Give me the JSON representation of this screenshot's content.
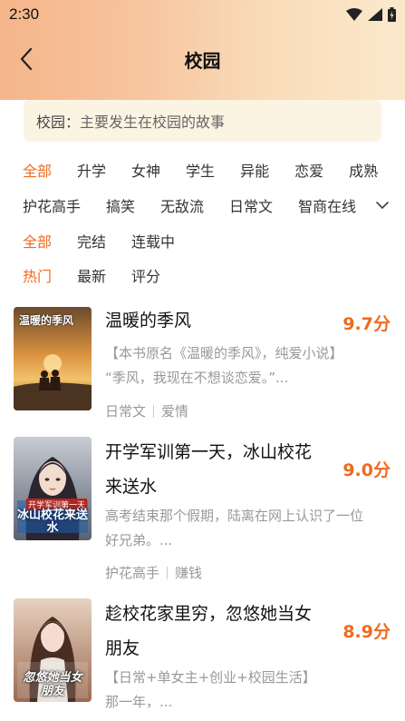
{
  "status": {
    "time": "2:30"
  },
  "header": {
    "title": "校园"
  },
  "description": {
    "label": "校园：",
    "text": "主要发生在校园的故事"
  },
  "filters": {
    "tags_row1": [
      "全部",
      "升学",
      "女神",
      "学生",
      "异能",
      "恋爱",
      "成熟"
    ],
    "tags_row2": [
      "护花高手",
      "搞笑",
      "无敌流",
      "日常文",
      "智商在线"
    ],
    "status": [
      "全部",
      "完结",
      "连载中"
    ],
    "sort": [
      "热门",
      "最新",
      "评分"
    ]
  },
  "books": [
    {
      "title": "温暖的季风",
      "score": "9.7分",
      "desc_line1": "【本书原名《温暖的季风》，纯爱小说】",
      "desc_line2": "“季风，我现在不想谈恋爱。”...",
      "tags": [
        "日常文",
        "爱情"
      ],
      "cover_text": "温暖的季风"
    },
    {
      "title_line1": "开学军训第一天，冰山校花",
      "title_line2": "来送水",
      "score": "9.0分",
      "desc_line1": "高考结束那个假期，陆离在网上认识了一位",
      "desc_line2": "好兄弟。...",
      "tags": [
        "护花高手",
        "赚钱"
      ],
      "cover_text_top": "开学军训第一天",
      "cover_text_main": "冰山校花来送水"
    },
    {
      "title_line1": "趁校花家里穷，忽悠她当女",
      "title_line2": "朋友",
      "score": "8.9分",
      "desc_line1": "【日常+单女主+创业+校园生活】",
      "desc_line2": "那一年，...",
      "cover_text_main": "忽悠她当女朋友"
    }
  ],
  "colors": {
    "accent": "#f06a1e",
    "desc_bg": "#fbf4e3"
  }
}
